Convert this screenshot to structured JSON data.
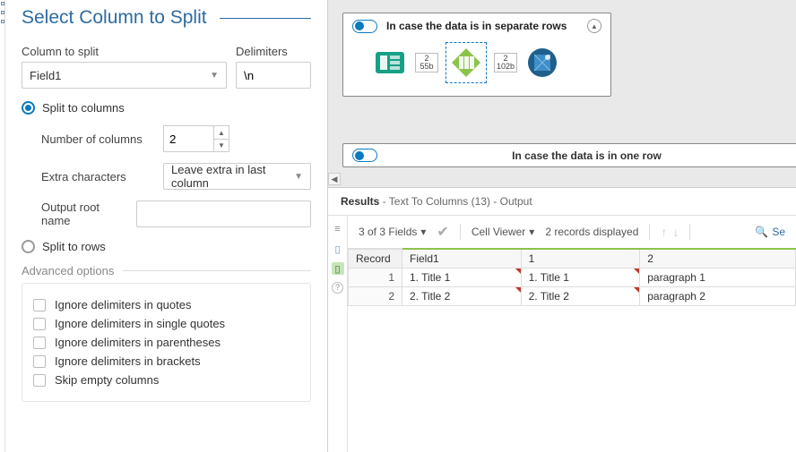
{
  "panel": {
    "title": "Select Column to Split",
    "col_to_split_label": "Column to split",
    "col_to_split_value": "Field1",
    "delimiters_label": "Delimiters",
    "delimiters_value": "\\n",
    "split_to_columns": "Split to columns",
    "num_cols_label": "Number of columns",
    "num_cols_value": "2",
    "extra_label": "Extra characters",
    "extra_value": "Leave extra in last column",
    "root_label": "Output root name",
    "root_value": "",
    "split_to_rows": "Split to rows",
    "advanced": "Advanced options",
    "opts": {
      "quotes": "Ignore delimiters in quotes",
      "single": "Ignore delimiters in single quotes",
      "paren": "Ignore delimiters in parentheses",
      "brackets": "Ignore delimiters in brackets",
      "skip": "Skip empty columns"
    }
  },
  "workflow": {
    "container1_title": "In case the data is in separate rows",
    "conn1_rows": "2",
    "conn1_size": "55b",
    "conn2_rows": "2",
    "conn2_size": "102b",
    "container2_title": "In case the data is in one row"
  },
  "results": {
    "header_bold": "Results",
    "header_rest": " - Text To Columns (13) - Output",
    "fields_dd": "3 of 3 Fields",
    "cell_viewer": "Cell Viewer",
    "records": "2 records displayed",
    "search": "Se",
    "columns": {
      "rec": "Record",
      "f1": "Field1",
      "c1": "1",
      "c2": "2"
    },
    "rows": [
      {
        "rec": "1",
        "f1": "1. Title 1",
        "c1": "1. Title 1",
        "c2": "paragraph 1"
      },
      {
        "rec": "2",
        "f1": "2. Title 2",
        "c1": "2. Title 2",
        "c2": "paragraph 2"
      }
    ]
  }
}
